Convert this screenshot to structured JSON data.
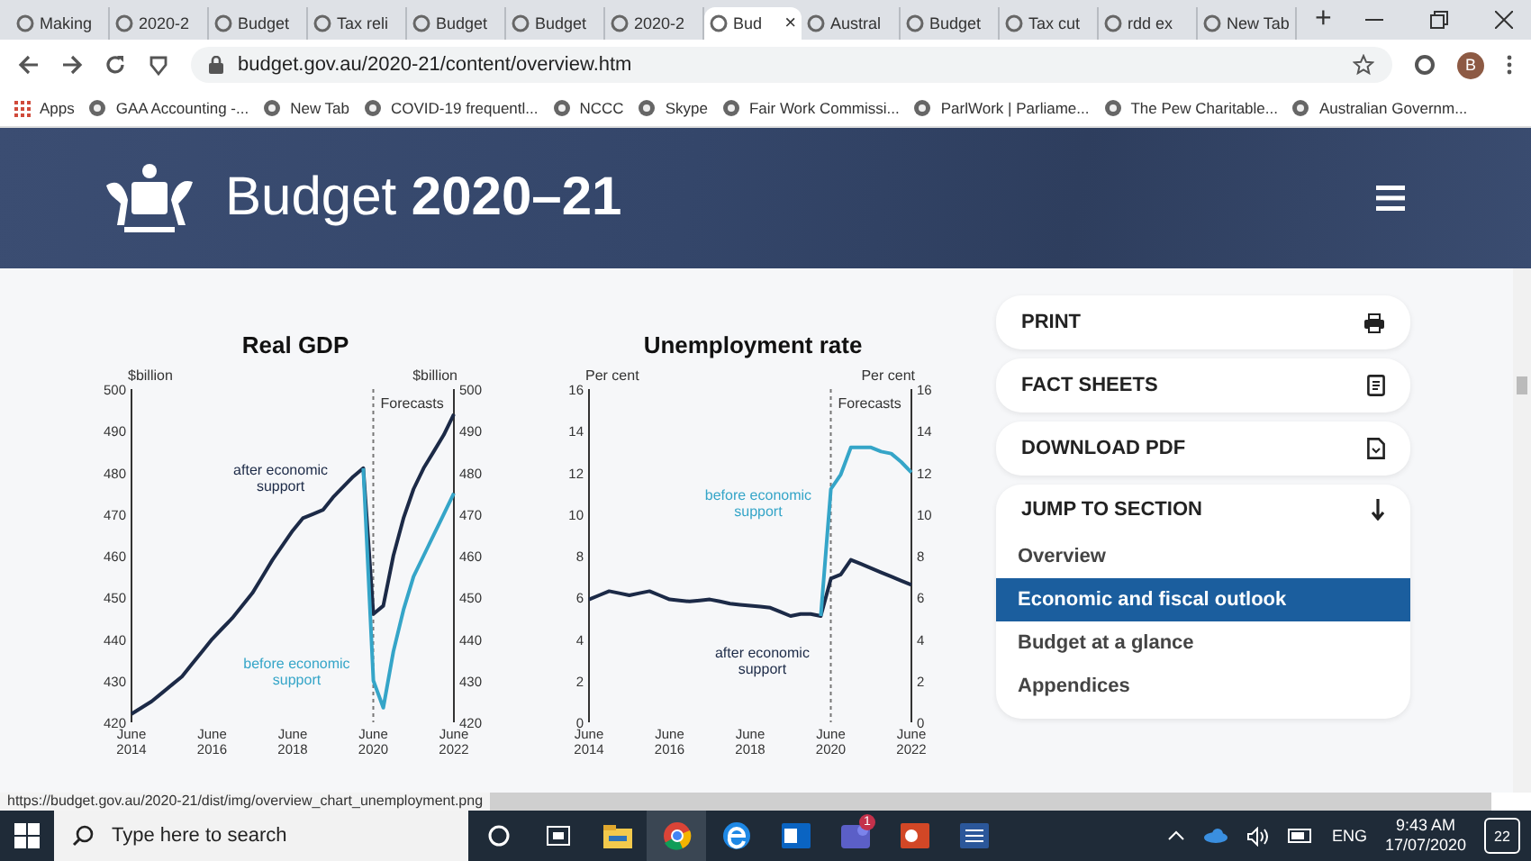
{
  "browser": {
    "tabs": [
      {
        "title": "Making",
        "selected": false
      },
      {
        "title": "2020-2",
        "selected": false
      },
      {
        "title": "Budget",
        "selected": false
      },
      {
        "title": "Tax reli",
        "selected": false
      },
      {
        "title": "Budget",
        "selected": false
      },
      {
        "title": "Budget",
        "selected": false
      },
      {
        "title": "2020-2",
        "selected": false
      },
      {
        "title": "Bud",
        "selected": true
      },
      {
        "title": "Austral",
        "selected": false
      },
      {
        "title": "Budget",
        "selected": false
      },
      {
        "title": "Tax cut",
        "selected": false
      },
      {
        "title": "rdd ex",
        "selected": false
      },
      {
        "title": "New Tab",
        "selected": false
      }
    ],
    "tab_close": "×",
    "new_tab": "+",
    "address": "budget.gov.au/2020-21/content/overview.htm",
    "profile": "B",
    "bookmarks": [
      "Apps",
      "GAA Accounting -...",
      "New Tab",
      "COVID-19 frequentl...",
      "NCCC",
      "Skype",
      "Fair Work Commissi...",
      "ParlWork | Parliame...",
      "The Pew Charitable...",
      "Australian Governm..."
    ]
  },
  "site": {
    "title": "Budget **2020–21**"
  },
  "charts": [
    {
      "chart_data": {
        "type": "line",
        "title": "Real GDP",
        "ylabel": "$billion",
        "y2label": "$billion",
        "ylim": [
          420,
          500
        ],
        "y2lim": [
          420,
          500
        ],
        "categories": [
          "June 2014",
          null,
          null,
          null,
          null,
          null,
          null,
          null,
          "June 2016",
          null,
          null,
          null,
          null,
          null,
          null,
          null,
          "June 2018",
          null,
          null,
          null,
          null,
          null,
          null,
          null,
          "June 2020",
          null,
          null,
          null,
          null,
          null,
          null,
          null,
          "June 2022"
        ],
        "yticks": [
          420,
          430,
          440,
          450,
          460,
          470,
          480,
          490,
          500
        ],
        "y2ticks": [
          420,
          430,
          440,
          450,
          460,
          470,
          480,
          490,
          500
        ],
        "series": [
          {
            "name": "after economic support",
            "color": "#1c2a47",
            "values": [
              422,
              423.5,
              425,
              427,
              429,
              431,
              434,
              437,
              440,
              442.5,
              445,
              448,
              451,
              455,
              459,
              462.5,
              466,
              469,
              470,
              471,
              474,
              476.5,
              479,
              481,
              446,
              448,
              460,
              469,
              476,
              481,
              485,
              489,
              494
            ]
          },
          {
            "name": "before economic support",
            "color": "#35a5c8",
            "values": [
              null,
              null,
              null,
              null,
              null,
              null,
              null,
              null,
              null,
              null,
              null,
              null,
              null,
              null,
              null,
              null,
              null,
              null,
              null,
              null,
              null,
              null,
              null,
              481,
              430,
              423.5,
              437,
              447,
              455,
              460,
              465,
              470,
              475
            ]
          }
        ],
        "annotations": [
          "Forecasts"
        ]
      }
    },
    {
      "chart_data": {
        "type": "line",
        "title": "Unemployment rate",
        "ylabel": "Per cent",
        "y2label": "Per cent",
        "ylim": [
          0,
          16
        ],
        "y2lim": [
          0,
          16
        ],
        "categories": [
          "June 2014",
          null,
          null,
          null,
          null,
          null,
          null,
          null,
          "June 2016",
          null,
          null,
          null,
          null,
          null,
          null,
          null,
          "June 2018",
          null,
          null,
          null,
          null,
          null,
          null,
          null,
          "June 2020",
          null,
          null,
          null,
          null,
          null,
          null,
          null,
          "June 2022"
        ],
        "yticks": [
          0,
          2,
          4,
          6,
          8,
          10,
          12,
          14,
          16
        ],
        "y2ticks": [
          0,
          2,
          4,
          6,
          8,
          10,
          12,
          14,
          16
        ],
        "series": [
          {
            "name": "after economic support",
            "color": "#1c2a47",
            "values": [
              5.9,
              6.1,
              6.3,
              6.2,
              6.1,
              6.2,
              6.3,
              6.1,
              5.9,
              5.85,
              5.8,
              5.85,
              5.9,
              5.8,
              5.7,
              5.65,
              5.6,
              5.55,
              5.5,
              5.3,
              5.1,
              5.2,
              5.2,
              5.1,
              6.9,
              7.1,
              7.8,
              7.6,
              7.4,
              7.2,
              7.0,
              6.8,
              6.6
            ]
          },
          {
            "name": "before economic support",
            "color": "#35a5c8",
            "values": [
              null,
              null,
              null,
              null,
              null,
              null,
              null,
              null,
              null,
              null,
              null,
              null,
              null,
              null,
              null,
              null,
              null,
              null,
              null,
              null,
              null,
              null,
              null,
              5.1,
              11.2,
              11.9,
              13.2,
              13.2,
              13.2,
              13.0,
              12.9,
              12.5,
              12.0
            ]
          }
        ],
        "annotations": [
          "Forecasts"
        ]
      }
    }
  ],
  "sidebar": {
    "actions": [
      {
        "label": "PRINT",
        "kind": "print"
      },
      {
        "label": "FACT SHEETS",
        "kind": "sheet"
      },
      {
        "label": "DOWNLOAD PDF",
        "kind": "pdf"
      }
    ],
    "jump": {
      "heading": "JUMP TO SECTION",
      "items": [
        {
          "label": "Overview",
          "selected": false
        },
        {
          "label": "Economic and fiscal outlook",
          "selected": true
        },
        {
          "label": "Budget at a glance",
          "selected": false
        },
        {
          "label": "Appendices",
          "selected": false
        }
      ]
    }
  },
  "status_url": "https://budget.gov.au/2020-21/dist/img/overview_chart_unemployment.png",
  "taskbar": {
    "placeholder": "Type here to search",
    "teams_badge": "1",
    "language": "ENG",
    "time": "9:43 AM",
    "date": "17/07/2020",
    "notifications": "22"
  }
}
